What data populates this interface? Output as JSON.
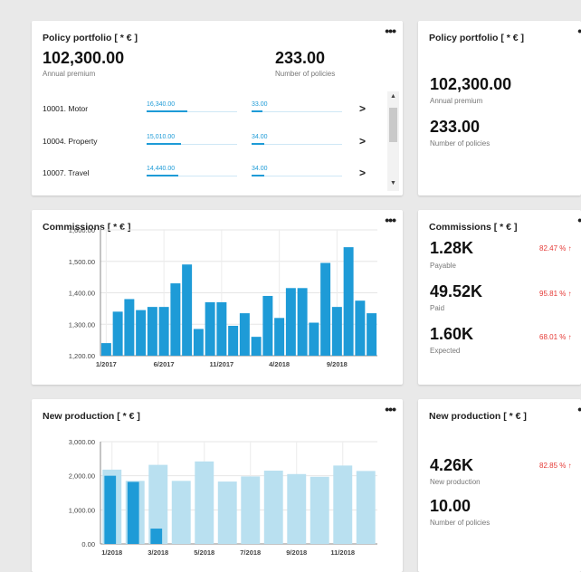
{
  "colors": {
    "accent": "#1e9bd7",
    "accent_light": "#b9e0f0",
    "negative": "#e53935"
  },
  "portfolio": {
    "title": "Policy portfolio [ * € ]",
    "premium_value": "102,300.00",
    "premium_label": "Annual premium",
    "policies_value": "233.00",
    "policies_label": "Number of policies",
    "rows": [
      {
        "label": "10001. Motor",
        "premium": "16,340.00",
        "premium_fill": 0.45,
        "count": "33.00",
        "count_fill": 0.12
      },
      {
        "label": "10004. Property",
        "premium": "15,010.00",
        "premium_fill": 0.38,
        "count": "34.00",
        "count_fill": 0.14
      },
      {
        "label": "10007. Travel",
        "premium": "14,440.00",
        "premium_fill": 0.35,
        "count": "34.00",
        "count_fill": 0.14
      }
    ]
  },
  "commissions_chart": {
    "title": "Commissions [ * € ]",
    "chart_data": {
      "type": "bar",
      "y_ticks": [
        "1,200.00",
        "1,300.00",
        "1,400.00",
        "1,500.00",
        "1,600.00"
      ],
      "x_ticks": [
        "1/2017",
        "6/2017",
        "11/2017",
        "4/2018",
        "9/2018"
      ],
      "ylim": [
        1200,
        1600
      ],
      "values": [
        1240,
        1340,
        1380,
        1345,
        1355,
        1355,
        1430,
        1490,
        1285,
        1370,
        1370,
        1295,
        1335,
        1260,
        1390,
        1320,
        1415,
        1415,
        1305,
        1495,
        1355,
        1545,
        1375,
        1335
      ],
      "grid": true
    }
  },
  "production_chart": {
    "title": "New production [ * € ]",
    "chart_data": {
      "type": "bar",
      "y_ticks": [
        "0.00",
        "1,000.00",
        "2,000.00",
        "3,000.00"
      ],
      "x_ticks": [
        "1/2018",
        "3/2018",
        "5/2018",
        "7/2018",
        "9/2018",
        "11/2018"
      ],
      "ylim": [
        0,
        3000
      ],
      "series": [
        {
          "values": [
            2180,
            1850,
            2320,
            1850,
            2420,
            1830,
            1980,
            2150,
            2050,
            1970,
            2300,
            2140
          ]
        },
        {
          "values": [
            2000,
            1820,
            450,
            null,
            null,
            null,
            null,
            null,
            null,
            null,
            null,
            null
          ]
        }
      ],
      "grid": true
    }
  },
  "portfolio_kpi": {
    "title": "Policy portfolio [ * € ]",
    "premium_value": "102,300.00",
    "premium_label": "Annual premium",
    "policies_value": "233.00",
    "policies_label": "Number of policies"
  },
  "commissions_kpi": {
    "title": "Commissions [ * € ]",
    "items": [
      {
        "value": "1.28K",
        "label": "Payable",
        "pct": "82.47 % ↑"
      },
      {
        "value": "49.52K",
        "label": "Paid",
        "pct": "95.81 % ↑"
      },
      {
        "value": "1.60K",
        "label": "Expected",
        "pct": "68.01 % ↑"
      }
    ]
  },
  "production_kpi": {
    "title": "New production [ * € ]",
    "production_value": "4.26K",
    "production_label": "New production",
    "production_pct": "82.85 % ↑",
    "policies_value": "10.00",
    "policies_label": "Number of policies"
  },
  "menu": {
    "dots": "•••"
  }
}
